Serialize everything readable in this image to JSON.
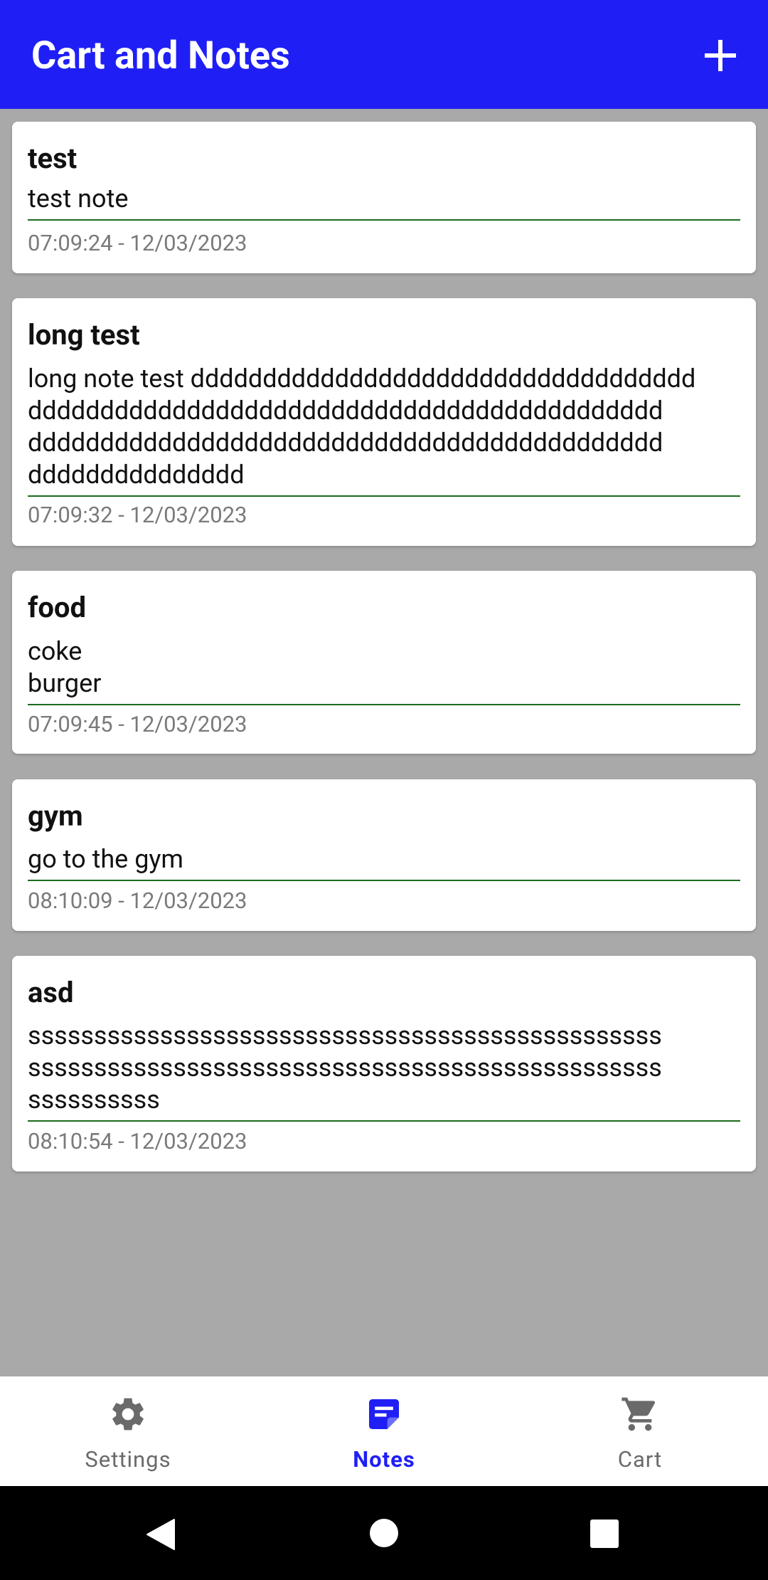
{
  "appbar": {
    "title": "Cart and Notes",
    "add_icon": "plus-icon"
  },
  "notes": [
    {
      "title": "test",
      "body": "test note",
      "timestamp": "07:09:24 - 12/03/2023"
    },
    {
      "title": "long test",
      "body": "long note test ddddddddddddddddddddddddddddddddddd\ndddddddddddddddddddddddddddddddddddddddddddd\ndddddddddddddddddddddddddddddddddddddddddddd\nddddddddddddddd",
      "timestamp": "07:09:32 - 12/03/2023"
    },
    {
      "title": "food",
      "body": "coke\nburger",
      "timestamp": "07:09:45 - 12/03/2023"
    },
    {
      "title": "gym",
      "body": "go to the gym",
      "timestamp": "08:10:09 - 12/03/2023"
    },
    {
      "title": "asd",
      "body": "ssssssssssssssssssssssssssssssssssssssssssssssss\nssssssssssssssssssssssssssssssssssssssssssssssss\nssssssssss",
      "timestamp": "08:10:54 - 12/03/2023"
    }
  ],
  "bottom_nav": {
    "items": [
      {
        "label": "Settings",
        "icon": "gear-icon"
      },
      {
        "label": "Notes",
        "icon": "notes-icon",
        "active": true
      },
      {
        "label": "Cart",
        "icon": "cart-icon"
      }
    ]
  },
  "system_nav": {
    "back": "back-icon",
    "home": "home-icon",
    "recents": "recents-icon"
  },
  "colors": {
    "accent": "#1f1ff5",
    "background": "#a9a9a9",
    "divider": "#1b6b1b"
  }
}
